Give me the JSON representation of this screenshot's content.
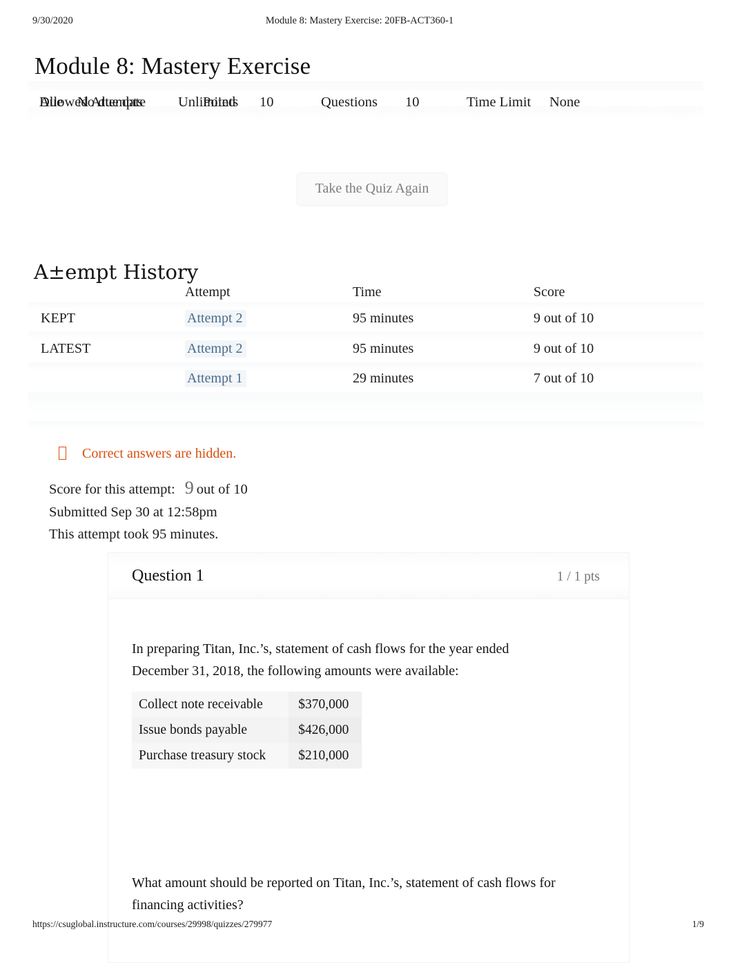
{
  "print_header": {
    "date": "9/30/2020",
    "doc_title": "Module 8: Mastery Exercise: 20FB-ACT360-1"
  },
  "page_title": "Module 8: Mastery Exercise",
  "quiz_meta": {
    "due_label": "Due",
    "due_value": "No due date",
    "points_label": "Points",
    "points_value": "10",
    "questions_label": "Questions",
    "questions_value": "10",
    "time_limit_label": "Time Limit",
    "time_limit_value": "None",
    "allowed_attempts_label": "Allowed Attempts",
    "allowed_attempts_value": "Unlimited"
  },
  "retake_button": "Take the Quiz Again",
  "attempt_history": {
    "heading": "A±empt History",
    "columns": [
      "",
      "Attempt",
      "Time",
      "Score"
    ],
    "rows": [
      {
        "tag": "KEPT",
        "attempt": "Attempt 2",
        "time": "95 minutes",
        "score": "9 out of 10"
      },
      {
        "tag": "LATEST",
        "attempt": "Attempt 2",
        "time": "95 minutes",
        "score": "9 out of 10"
      },
      {
        "tag": "",
        "attempt": "Attempt 1",
        "time": "29 minutes",
        "score": "7 out of 10"
      }
    ]
  },
  "hidden_notice": {
    "icon": "missing-glyph-box-icon",
    "text": "Correct answers are hidden."
  },
  "attempt_summary": {
    "score_label": "Score for this attempt:",
    "score_value": "9",
    "score_out_of": "out of 10",
    "submitted": "Submitted Sep 30 at 12:58pm",
    "duration": "This attempt took 95 minutes."
  },
  "question": {
    "title": "Question 1",
    "points": "1 / 1 pts",
    "prompt": "In preparing Titan, Inc.’s, statement of cash flows for the year ended December 31, 2018, the following amounts were available:",
    "amounts": [
      {
        "label": "Collect note receivable",
        "value": "$370,000"
      },
      {
        "label": "Issue bonds payable",
        "value": "$426,000"
      },
      {
        "label": "Purchase treasury stock",
        "value": "$210,000"
      }
    ],
    "question_text": "What amount should be reported on Titan, Inc.’s, statement of cash flows for financing activities?"
  },
  "print_footer": {
    "url": "https://csuglobal.instructure.com/courses/29998/quizzes/279977",
    "page": "1/9"
  },
  "colors": {
    "link": "#4b6a8c",
    "notice": "#d6500f",
    "muted": "#757575"
  }
}
